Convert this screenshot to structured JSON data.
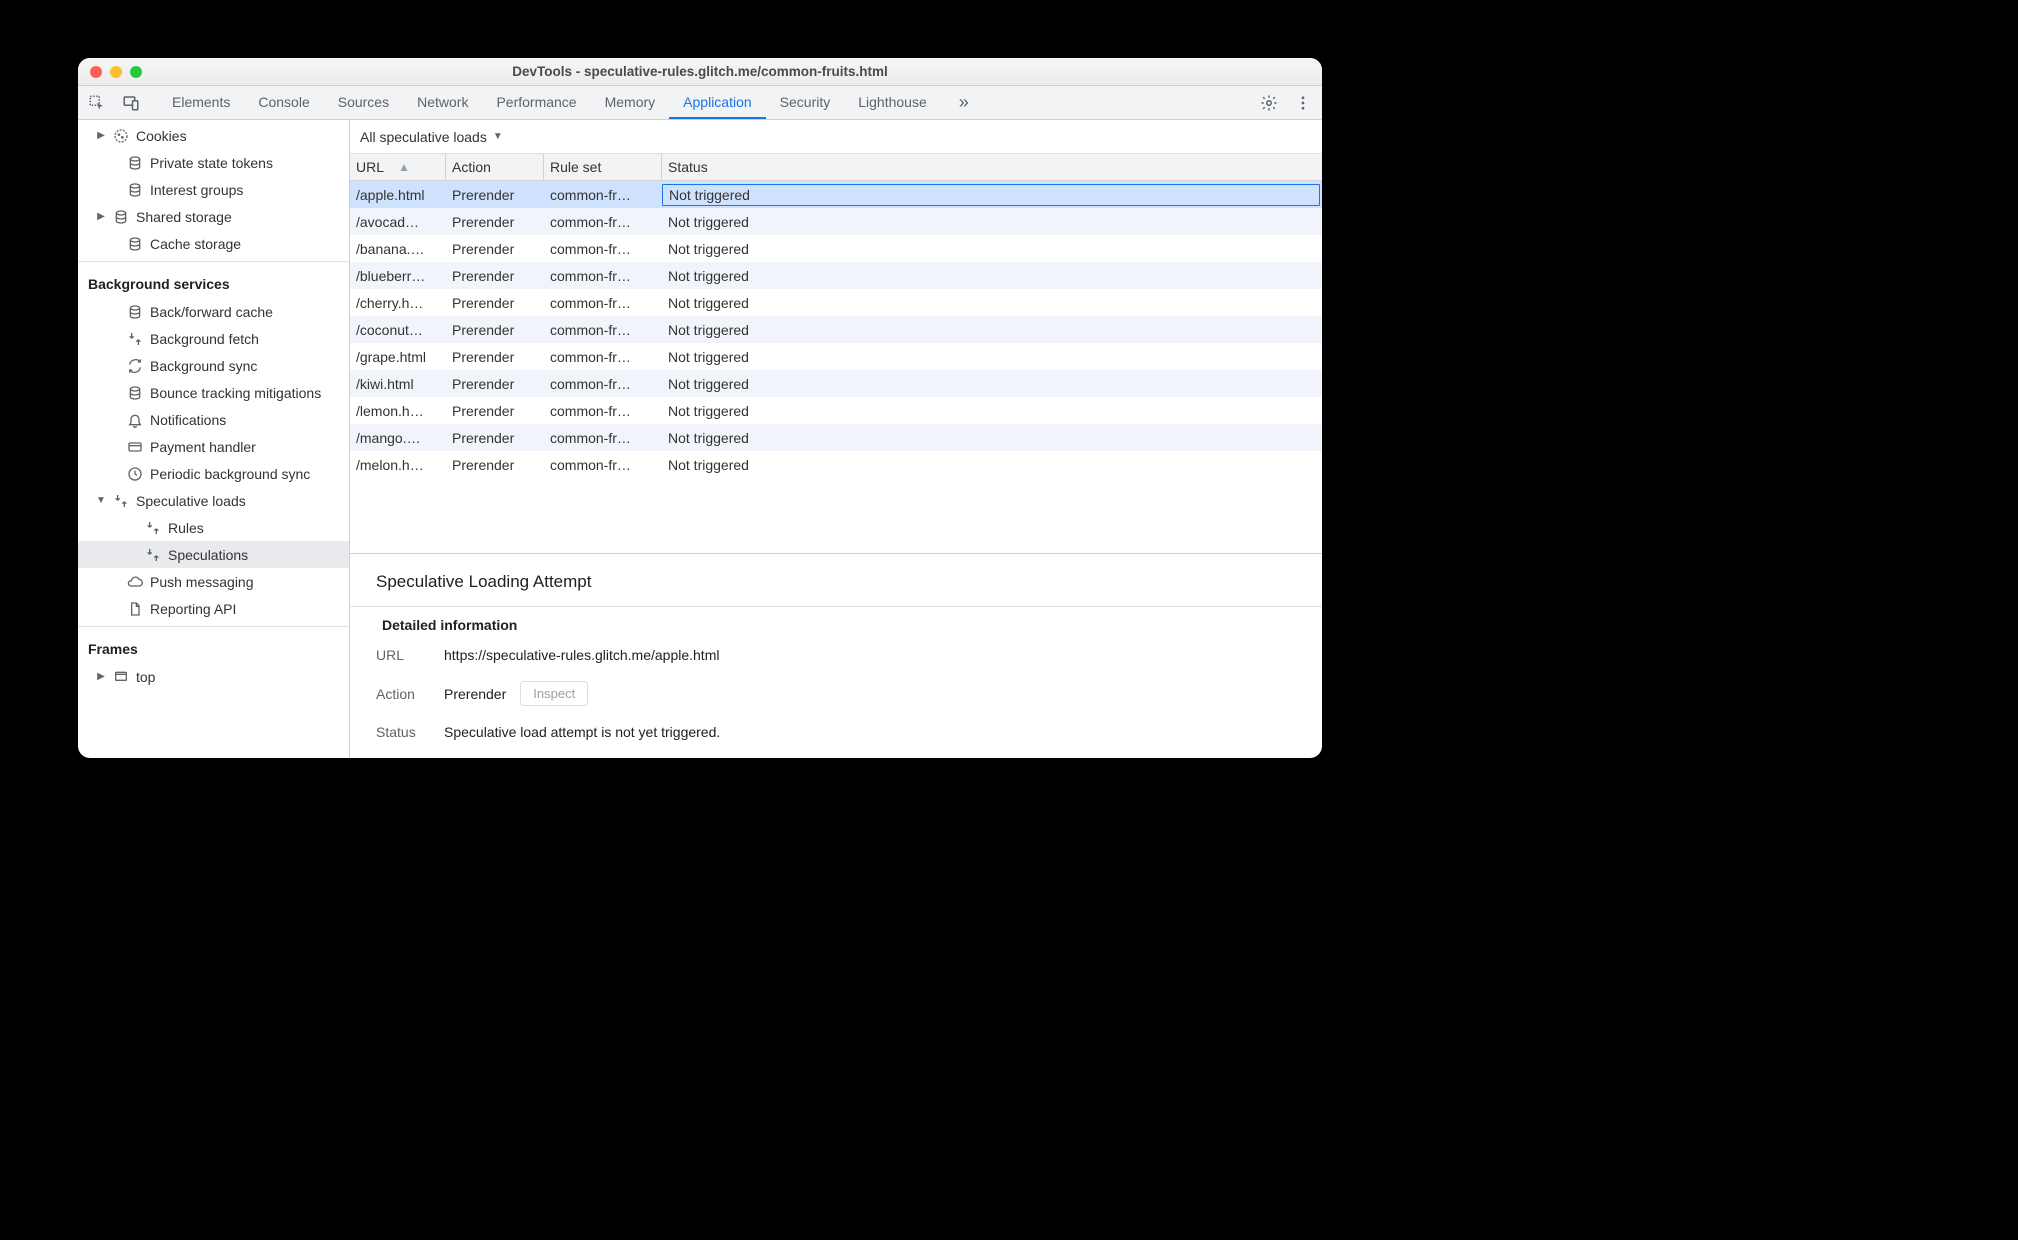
{
  "window": {
    "title": "DevTools - speculative-rules.glitch.me/common-fruits.html"
  },
  "toolbar": {
    "tabs": [
      {
        "label": "Elements"
      },
      {
        "label": "Console"
      },
      {
        "label": "Sources"
      },
      {
        "label": "Network"
      },
      {
        "label": "Performance"
      },
      {
        "label": "Memory"
      },
      {
        "label": "Application",
        "active": true
      },
      {
        "label": "Security"
      },
      {
        "label": "Lighthouse"
      }
    ],
    "overflow": "»"
  },
  "sidebar": {
    "groupA": [
      {
        "label": "Cookies",
        "icon": "cookie",
        "disclosure": "▶",
        "indent": 18
      },
      {
        "label": "Private state tokens",
        "icon": "db",
        "indent": 32
      },
      {
        "label": "Interest groups",
        "icon": "db",
        "indent": 32
      },
      {
        "label": "Shared storage",
        "icon": "db",
        "disclosure": "▶",
        "indent": 18
      },
      {
        "label": "Cache storage",
        "icon": "db",
        "indent": 32
      }
    ],
    "bg_header": "Background services",
    "bg_items": [
      {
        "label": "Back/forward cache",
        "icon": "db",
        "indent": 32
      },
      {
        "label": "Background fetch",
        "icon": "fetch",
        "indent": 32
      },
      {
        "label": "Background sync",
        "icon": "sync",
        "indent": 32
      },
      {
        "label": "Bounce tracking mitigations",
        "icon": "db",
        "indent": 32
      },
      {
        "label": "Notifications",
        "icon": "bell",
        "indent": 32
      },
      {
        "label": "Payment handler",
        "icon": "card",
        "indent": 32
      },
      {
        "label": "Periodic background sync",
        "icon": "clock",
        "indent": 32
      },
      {
        "label": "Speculative loads",
        "icon": "fetch",
        "disclosure": "▼",
        "indent": 18
      },
      {
        "label": "Rules",
        "icon": "fetch",
        "indent": 50
      },
      {
        "label": "Speculations",
        "icon": "fetch",
        "indent": 50,
        "selected": true
      },
      {
        "label": "Push messaging",
        "icon": "cloud",
        "indent": 32
      },
      {
        "label": "Reporting API",
        "icon": "doc",
        "indent": 32
      }
    ],
    "frames_header": "Frames",
    "frames_items": [
      {
        "label": "top",
        "icon": "frame",
        "disclosure": "▶",
        "indent": 18
      }
    ]
  },
  "main": {
    "filter": "All speculative loads",
    "columns": {
      "url": "URL",
      "action": "Action",
      "ruleset": "Rule set",
      "status": "Status"
    },
    "rows": [
      {
        "url": "/apple.html",
        "action": "Prerender",
        "ruleset": "common-fr…",
        "status": "Not triggered",
        "selected": true
      },
      {
        "url": "/avocad…",
        "action": "Prerender",
        "ruleset": "common-fr…",
        "status": "Not triggered"
      },
      {
        "url": "/banana.…",
        "action": "Prerender",
        "ruleset": "common-fr…",
        "status": "Not triggered"
      },
      {
        "url": "/blueberr…",
        "action": "Prerender",
        "ruleset": "common-fr…",
        "status": "Not triggered"
      },
      {
        "url": "/cherry.h…",
        "action": "Prerender",
        "ruleset": "common-fr…",
        "status": "Not triggered"
      },
      {
        "url": "/coconut…",
        "action": "Prerender",
        "ruleset": "common-fr…",
        "status": "Not triggered"
      },
      {
        "url": "/grape.html",
        "action": "Prerender",
        "ruleset": "common-fr…",
        "status": "Not triggered"
      },
      {
        "url": "/kiwi.html",
        "action": "Prerender",
        "ruleset": "common-fr…",
        "status": "Not triggered"
      },
      {
        "url": "/lemon.h…",
        "action": "Prerender",
        "ruleset": "common-fr…",
        "status": "Not triggered"
      },
      {
        "url": "/mango.…",
        "action": "Prerender",
        "ruleset": "common-fr…",
        "status": "Not triggered"
      },
      {
        "url": "/melon.h…",
        "action": "Prerender",
        "ruleset": "common-fr…",
        "status": "Not triggered"
      }
    ],
    "details": {
      "heading": "Speculative Loading Attempt",
      "subheading": "Detailed information",
      "url_label": "URL",
      "url_value": "https://speculative-rules.glitch.me/apple.html",
      "action_label": "Action",
      "action_value": "Prerender",
      "inspect_label": "Inspect",
      "status_label": "Status",
      "status_value": "Speculative load attempt is not yet triggered."
    }
  }
}
